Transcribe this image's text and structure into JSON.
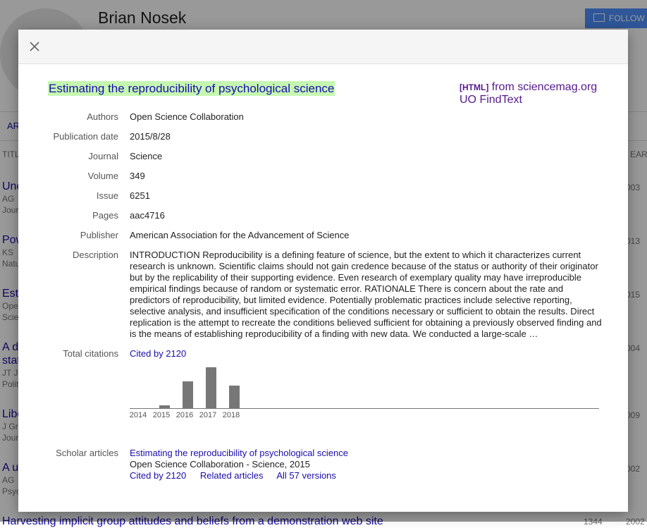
{
  "background": {
    "profile_name": "Brian Nosek",
    "follow_label": "FOLLOW",
    "tab_label": "AR",
    "col_title": "TITL",
    "col_year": "EAR",
    "rows": [
      {
        "title": "Unc",
        "sub1": "AG",
        "sub2": "Jour",
        "year": "003"
      },
      {
        "title": "Pow",
        "sub1": "KS",
        "sub2": "Natu",
        "year": "013"
      },
      {
        "title": "Est",
        "sub1": "Ope",
        "sub2": "Scie",
        "year": "015"
      },
      {
        "title": "A d",
        "sub1": "stat",
        "sub2": "JT J",
        "sub3": "Polit",
        "year": "004"
      },
      {
        "title": "Libe",
        "sub1": "J Gr",
        "sub2": "Jour",
        "year": "009"
      },
      {
        "title": "A u",
        "sub1": "AG",
        "sub2": "Psyc",
        "year": "002"
      }
    ],
    "bottom_title": "Harvesting implicit group attitudes and beliefs from a demonstration web site",
    "bottom_cites": "1344",
    "bottom_year": "2002"
  },
  "dialog": {
    "title": "Estimating the reproducibility of psychological science",
    "html_tag": "[HTML]",
    "html_source": "from sciencemag.org",
    "findtext": "UO FindText",
    "fields": {
      "authors_label": "Authors",
      "authors": "Open Science Collaboration",
      "pubdate_label": "Publication date",
      "pubdate": "2015/8/28",
      "journal_label": "Journal",
      "journal": "Science",
      "volume_label": "Volume",
      "volume": "349",
      "issue_label": "Issue",
      "issue": "6251",
      "pages_label": "Pages",
      "pages": "aac4716",
      "publisher_label": "Publisher",
      "publisher": "American Association for the Advancement of Science",
      "description_label": "Description",
      "description": "INTRODUCTION Reproducibility is a defining feature of science, but the extent to which it characterizes current research is unknown. Scientific claims should not gain credence because of the status or authority of their originator but by the replicability of their supporting evidence. Even research of exemplary quality may have irreproducible empirical findings because of random or systematic error. RATIONALE There is concern about the rate and predictors of reproducibility, but limited evidence. Potentially problematic practices include selective reporting, selective analysis, and insufficient specification of the conditions necessary or sufficient to obtain the results. Direct replication is the attempt to recreate the conditions believed sufficient for obtaining a previously observed finding and is the means of establishing reproducibility of a finding with new data. We conducted a large-scale …",
      "citations_label": "Total citations",
      "cited_by": "Cited by 2120",
      "scholar_label": "Scholar articles",
      "scholar_title": "Estimating the reproducibility of psychological science",
      "scholar_meta": "Open Science Collaboration - Science, 2015",
      "scholar_cited": "Cited by 2120",
      "scholar_related": "Related articles",
      "scholar_versions": "All 57 versions"
    }
  },
  "chart_data": {
    "type": "bar",
    "categories": [
      "2014",
      "2015",
      "2016",
      "2017",
      "2018"
    ],
    "values": [
      0,
      30,
      290,
      440,
      240
    ],
    "bar_color": "#777777"
  }
}
